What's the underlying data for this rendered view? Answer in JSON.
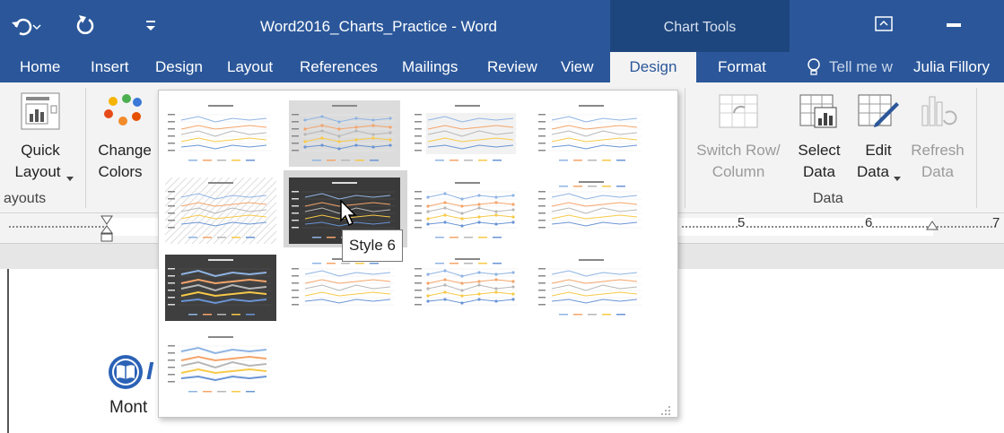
{
  "window": {
    "title": "Word2016_Charts_Practice - Word",
    "context_header": "Chart Tools"
  },
  "tabs": [
    {
      "label": "Home"
    },
    {
      "label": "Insert"
    },
    {
      "label": "Design"
    },
    {
      "label": "Layout"
    },
    {
      "label": "References"
    },
    {
      "label": "Mailings"
    },
    {
      "label": "Review"
    },
    {
      "label": "View"
    },
    {
      "label": "Design",
      "active": true
    },
    {
      "label": "Format"
    }
  ],
  "tell_me": "Tell me w",
  "user": "Julia Fillory",
  "ribbon": {
    "quick_layout": [
      "Quick",
      "Layout"
    ],
    "change_colors": [
      "Change",
      "Colors"
    ],
    "group_layouts": "ayouts",
    "switch_row": [
      "Switch Row/",
      "Column"
    ],
    "select_data": [
      "Select",
      "Data"
    ],
    "edit_data": [
      "Edit",
      "Data"
    ],
    "refresh_data": [
      "Refresh",
      "Data"
    ],
    "group_data": "Data"
  },
  "ruler": {
    "n5": "5",
    "n6": "6",
    "n7": "7"
  },
  "gallery": {
    "tooltip": "Style 6",
    "thumb_title": "Chart Title"
  },
  "document": {
    "partial_text": "Mont",
    "logo_letter": "I"
  },
  "colors": {
    "accent": "#2b579a",
    "context": "#1e467e"
  }
}
